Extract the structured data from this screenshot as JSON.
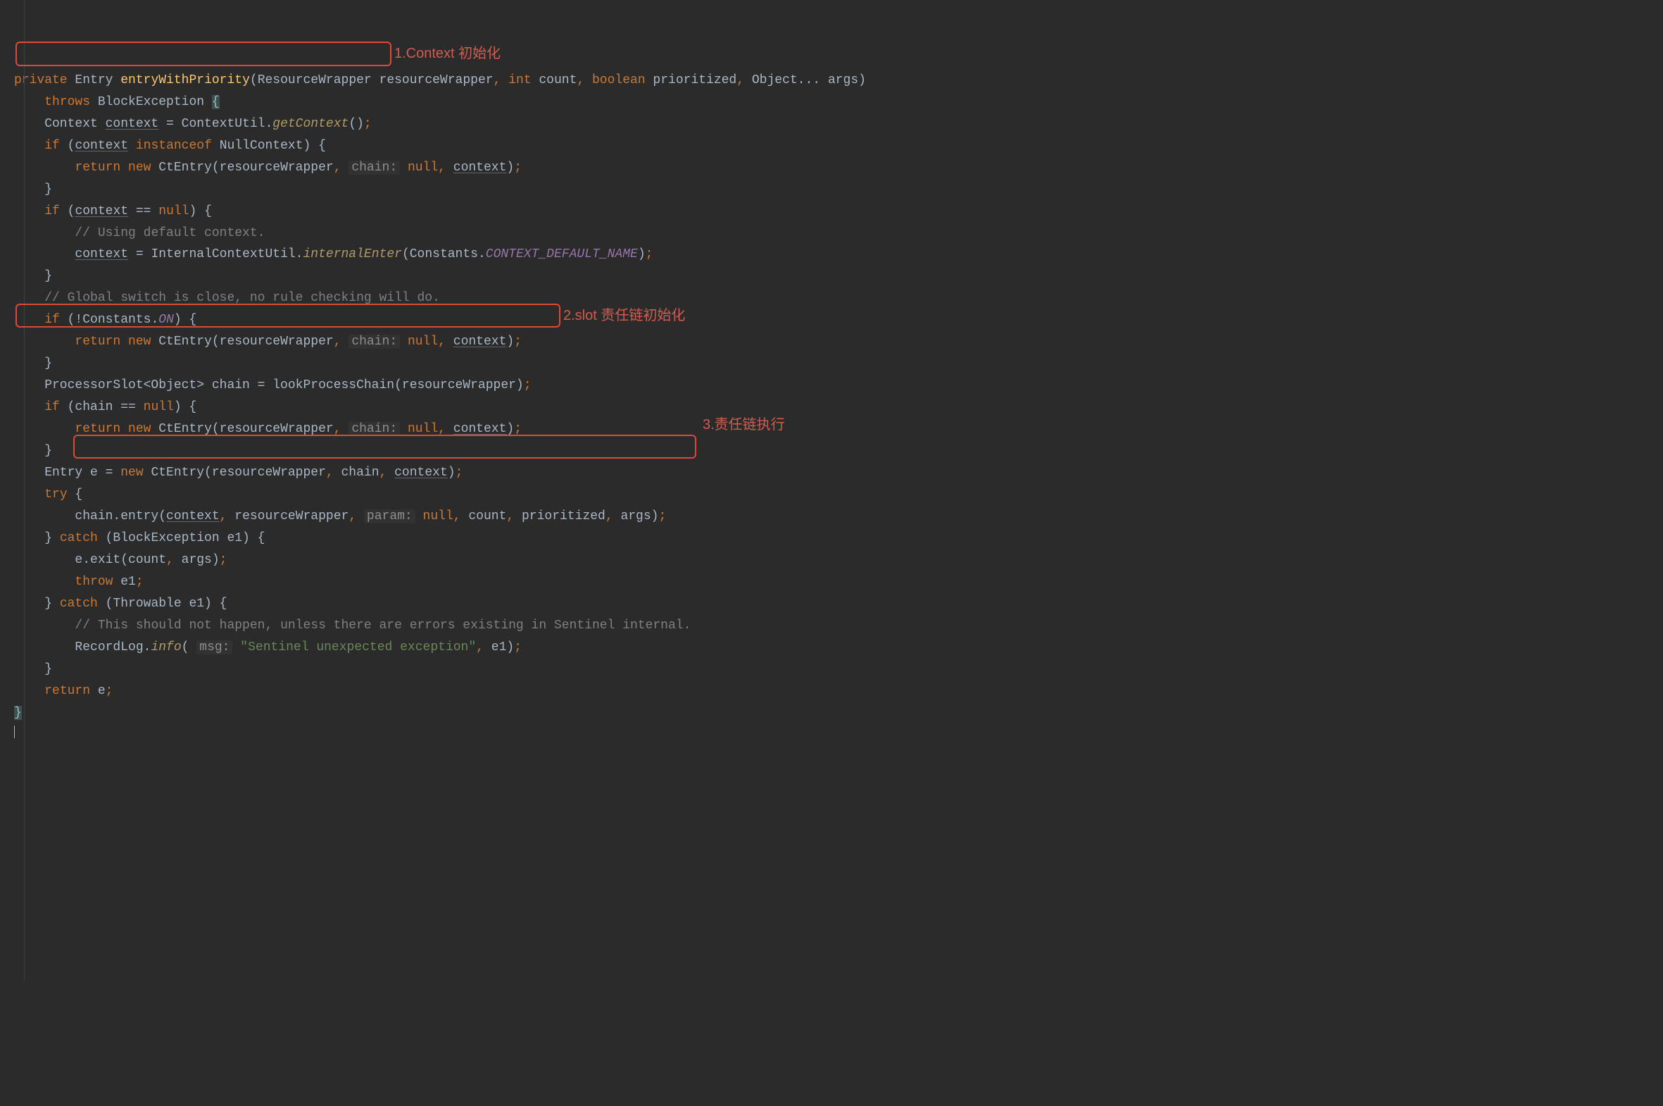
{
  "colors": {
    "bg": "#2b2b2b",
    "keyword": "#cc7832",
    "method": "#ffc66d",
    "string": "#6a8759",
    "comment": "#808080",
    "constant": "#9876aa",
    "hint": "#8e8e8e",
    "annotation": "#d15c50",
    "boxBorder": "#dd4a3a"
  },
  "annotations": {
    "a1": "1.Context 初始化",
    "a2": "2.slot 责任链初始化",
    "a3": "3.责任链执行"
  },
  "lines": {
    "l01": {
      "t1": "private",
      "t2": " Entry ",
      "t3": "entryWithPriority",
      "t4": "(ResourceWrapper resourceWrapper",
      "t5": ", ",
      "t6": "int",
      "t7": " count",
      "t8": ", ",
      "t9": "boolean",
      "t10": " prioritized",
      "t11": ", ",
      "t12": "Object... args)"
    },
    "l02": {
      "t1": "    ",
      "t2": "throws",
      "t3": " BlockException ",
      "t4": "{"
    },
    "l03": {
      "t1": "    Context ",
      "t2": "context",
      "t3": " = ContextUtil.",
      "t4": "getContext",
      "t5": "()",
      "t6": ";"
    },
    "l04": {
      "t1": "    ",
      "t2": "if",
      "t3": " (",
      "t4": "context",
      "t5": " ",
      "t6": "instanceof",
      "t7": " NullContext) {"
    },
    "l05": {
      "t1": "        ",
      "t2": "return new",
      "t3": " CtEntry(resourceWrapper",
      "t4": ", ",
      "t5": "chain:",
      "t6": " ",
      "t7": "null",
      "t8": ", ",
      "t9": "context",
      "t10": ")",
      "t11": ";"
    },
    "l06": {
      "t1": "    }"
    },
    "l07": {
      "t1": "    ",
      "t2": "if",
      "t3": " (",
      "t4": "context",
      "t5": " == ",
      "t6": "null",
      "t7": ") {"
    },
    "l08": {
      "t1": "        ",
      "t2": "// Using default context."
    },
    "l09": {
      "t1": "        ",
      "t2": "context",
      "t3": " = InternalContextUtil.",
      "t4": "internalEnter",
      "t5": "(Constants.",
      "t6": "CONTEXT_DEFAULT_NAME",
      "t7": ")",
      "t8": ";"
    },
    "l10": {
      "t1": "    }"
    },
    "l11": {
      "t1": "    ",
      "t2": "// Global switch is close, no rule checking will do."
    },
    "l12": {
      "t1": "    ",
      "t2": "if",
      "t3": " (!Constants.",
      "t4": "ON",
      "t5": ") {"
    },
    "l13": {
      "t1": "        ",
      "t2": "return new",
      "t3": " CtEntry(resourceWrapper",
      "t4": ", ",
      "t5": "chain:",
      "t6": " ",
      "t7": "null",
      "t8": ", ",
      "t9": "context",
      "t10": ")",
      "t11": ";"
    },
    "l14": {
      "t1": "    }"
    },
    "l15": {
      "t1": "    ProcessorSlot<Object> chain = lookProcessChain(resourceWrapper)",
      "t2": ";"
    },
    "l16": {
      "t1": "    ",
      "t2": "if",
      "t3": " (chain == ",
      "t4": "null",
      "t5": ") {"
    },
    "l17": {
      "t1": "        ",
      "t2": "return new",
      "t3": " CtEntry(resourceWrapper",
      "t4": ", ",
      "t5": "chain:",
      "t6": " ",
      "t7": "null",
      "t8": ", ",
      "t9": "context",
      "t10": ")",
      "t11": ";"
    },
    "l18": {
      "t1": "    }"
    },
    "l19": {
      "t1": "    Entry e = ",
      "t2": "new",
      "t3": " CtEntry(resourceWrapper",
      "t4": ", ",
      "t5": "chain",
      "t6": ", ",
      "t7": "context",
      "t8": ")",
      "t9": ";"
    },
    "l20": {
      "t1": "    ",
      "t2": "try",
      "t3": " {"
    },
    "l21": {
      "t1": "        chain.entry(",
      "t2": "context",
      "t3": ", ",
      "t4": "resourceWrapper",
      "t5": ", ",
      "t6": "param:",
      "t7": " ",
      "t8": "null",
      "t9": ", ",
      "t10": "count",
      "t11": ", ",
      "t12": "prioritized",
      "t13": ", ",
      "t14": "args)",
      "t15": ";"
    },
    "l22": {
      "t1": "    } ",
      "t2": "catch",
      "t3": " (BlockException e1) {"
    },
    "l23": {
      "t1": "        e.exit(count",
      "t2": ", ",
      "t3": "args)",
      "t4": ";"
    },
    "l24": {
      "t1": "        ",
      "t2": "throw",
      "t3": " e1",
      "t4": ";"
    },
    "l25": {
      "t1": "    } ",
      "t2": "catch",
      "t3": " (Throwable e1) {"
    },
    "l26": {
      "t1": "        ",
      "t2": "// This should not happen, unless there are errors existing in Sentinel internal."
    },
    "l27": {
      "t1": "        RecordLog.",
      "t2": "info",
      "t3": "( ",
      "t4": "msg:",
      "t5": " ",
      "t6": "\"Sentinel unexpected exception\"",
      "t7": ", ",
      "t8": "e1)",
      "t9": ";"
    },
    "l28": {
      "t1": "    }"
    },
    "l29": {
      "t1": "    ",
      "t2": "return",
      "t3": " e",
      "t4": ";"
    },
    "l30": {
      "t1": "}"
    }
  }
}
